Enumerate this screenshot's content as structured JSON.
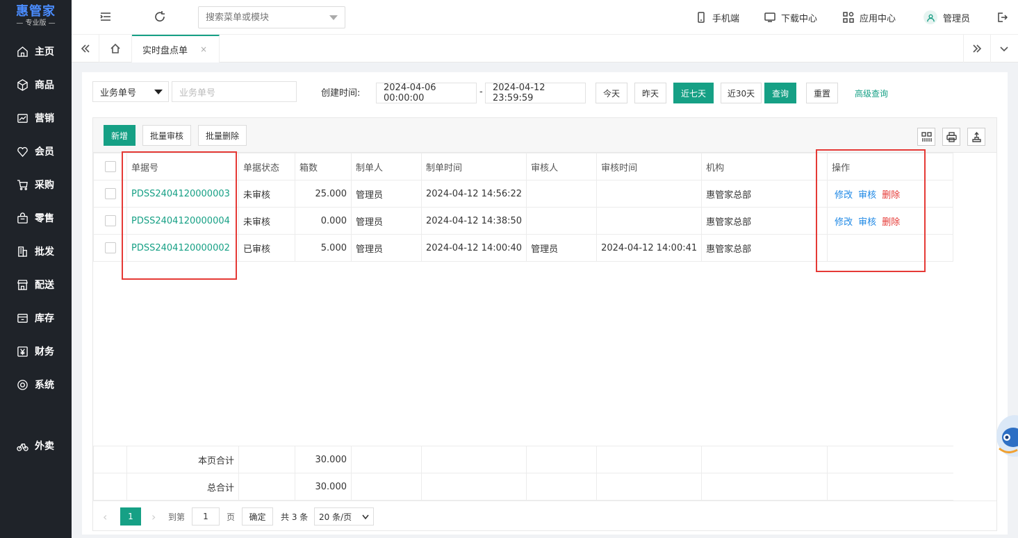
{
  "app": {
    "logo": "惠管家",
    "edition": "— 专业版 —"
  },
  "sidebar": {
    "items": [
      {
        "label": "主页",
        "icon": "home-icon"
      },
      {
        "label": "商品",
        "icon": "box-icon"
      },
      {
        "label": "营销",
        "icon": "chart-icon"
      },
      {
        "label": "会员",
        "icon": "heart-icon"
      },
      {
        "label": "采购",
        "icon": "cart-icon"
      },
      {
        "label": "零售",
        "icon": "bag-icon"
      },
      {
        "label": "批发",
        "icon": "building-icon"
      },
      {
        "label": "配送",
        "icon": "store-icon"
      },
      {
        "label": "库存",
        "icon": "inventory-icon"
      },
      {
        "label": "财务",
        "icon": "yen-icon"
      },
      {
        "label": "系统",
        "icon": "settings-icon"
      },
      {
        "label": "外卖",
        "icon": "bike-icon"
      }
    ]
  },
  "topbar": {
    "search_placeholder": "搜索菜单或模块",
    "mobile": "手机端",
    "download": "下载中心",
    "apps": "应用中心",
    "user": "管理员"
  },
  "tabs": {
    "active": "实时盘点单",
    "close": "×"
  },
  "filter": {
    "field_select": "业务单号",
    "field_placeholder": "业务单号",
    "time_label": "创建时间:",
    "start": "2024-04-06 00:00:00",
    "dash": "-",
    "end": "2024-04-12 23:59:59",
    "today": "今天",
    "yesterday": "昨天",
    "last7": "近七天",
    "last30": "近30天",
    "query": "查询",
    "reset": "重置",
    "advanced": "高级查询"
  },
  "toolbar": {
    "add": "新增",
    "batch_audit": "批量审核",
    "batch_delete": "批量删除"
  },
  "table": {
    "headers": [
      "单据号",
      "单据状态",
      "箱数",
      "制单人",
      "制单时间",
      "审核人",
      "审核时间",
      "机构",
      "操作"
    ],
    "rows": [
      {
        "bill": "PDSS2404120000003",
        "status": "未审核",
        "boxes": "25.000",
        "maker": "管理员",
        "make_time": "2024-04-12 14:56:22",
        "auditor": "",
        "audit_time": "",
        "org": "惠管家总部",
        "ops": [
          "修改",
          "审核",
          "删除"
        ]
      },
      {
        "bill": "PDSS2404120000004",
        "status": "未审核",
        "boxes": "0.000",
        "maker": "管理员",
        "make_time": "2024-04-12 14:38:50",
        "auditor": "",
        "audit_time": "",
        "org": "惠管家总部",
        "ops": [
          "修改",
          "审核",
          "删除"
        ]
      },
      {
        "bill": "PDSS2404120000002",
        "status": "已审核",
        "boxes": "5.000",
        "maker": "管理员",
        "make_time": "2024-04-12 14:00:40",
        "auditor": "管理员",
        "audit_time": "2024-04-12 14:00:41",
        "org": "惠管家总部",
        "ops": []
      }
    ],
    "page_total_label": "本页合计",
    "page_total": "30.000",
    "grand_total_label": "总合计",
    "grand_total": "30.000"
  },
  "pager": {
    "current": "1",
    "goto_label": "到第",
    "goto_value": "1",
    "page_unit": "页",
    "confirm": "确定",
    "total": "共 3 条",
    "page_size": "20 条/页"
  }
}
